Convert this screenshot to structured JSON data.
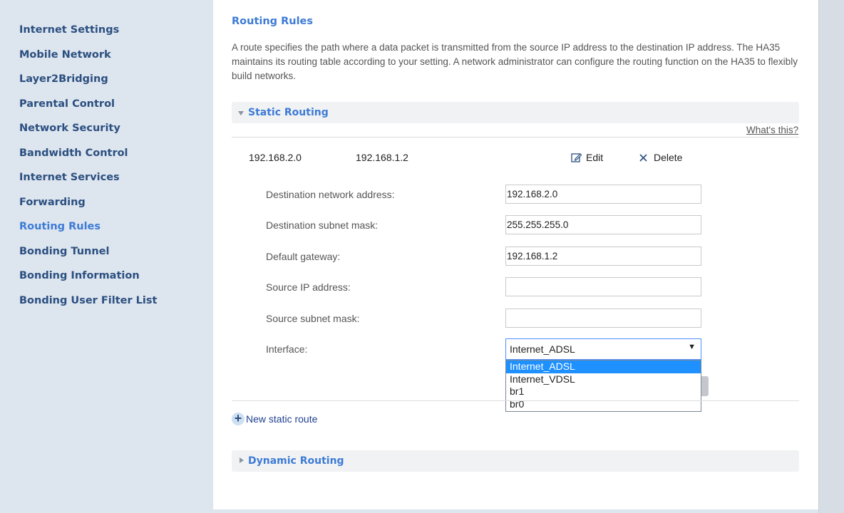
{
  "sidebar": {
    "items": [
      {
        "label": "Internet Settings"
      },
      {
        "label": "Mobile Network"
      },
      {
        "label": "Layer2Bridging"
      },
      {
        "label": "Parental Control"
      },
      {
        "label": "Network Security"
      },
      {
        "label": "Bandwidth Control"
      },
      {
        "label": "Internet Services"
      },
      {
        "label": "Forwarding"
      },
      {
        "label": "Routing Rules",
        "active": true
      },
      {
        "label": "Bonding Tunnel"
      },
      {
        "label": "Bonding Information"
      },
      {
        "label": "Bonding User Filter List"
      }
    ]
  },
  "page": {
    "title": "Routing Rules",
    "intro": "A route specifies the path where a data packet is transmitted from the source IP address to the destination IP address. The HA35 maintains its routing table according to your setting. A network administrator can configure the routing function on the HA35 to flexibly build networks."
  },
  "static_routing": {
    "title": "Static Routing",
    "whats_this": "What's this?",
    "route": {
      "destination": "192.168.2.0",
      "gateway": "192.168.1.2",
      "edit_label": "Edit",
      "delete_label": "Delete"
    },
    "form": {
      "dest_network_label": "Destination network address:",
      "dest_network_value": "192.168.2.0",
      "dest_mask_label": "Destination subnet mask:",
      "dest_mask_value": "255.255.255.0",
      "gateway_label": "Default gateway:",
      "gateway_value": "192.168.1.2",
      "src_ip_label": "Source IP address:",
      "src_ip_value": "",
      "src_mask_label": "Source subnet mask:",
      "src_mask_value": "",
      "interface_label": "Interface:",
      "interface_value": "Internet_ADSL",
      "interface_arrow": "▼",
      "interface_options": [
        "Internet_ADSL",
        "Internet_VDSL",
        "br1",
        "br0"
      ]
    },
    "new_route_label": "New static route"
  },
  "dynamic_routing": {
    "title": "Dynamic Routing"
  },
  "colors": {
    "accent": "#3d7bd6",
    "nav_text": "#2b4f80",
    "sidebar_bg": "#dde5ee",
    "selected_option": "#1e90ff"
  }
}
